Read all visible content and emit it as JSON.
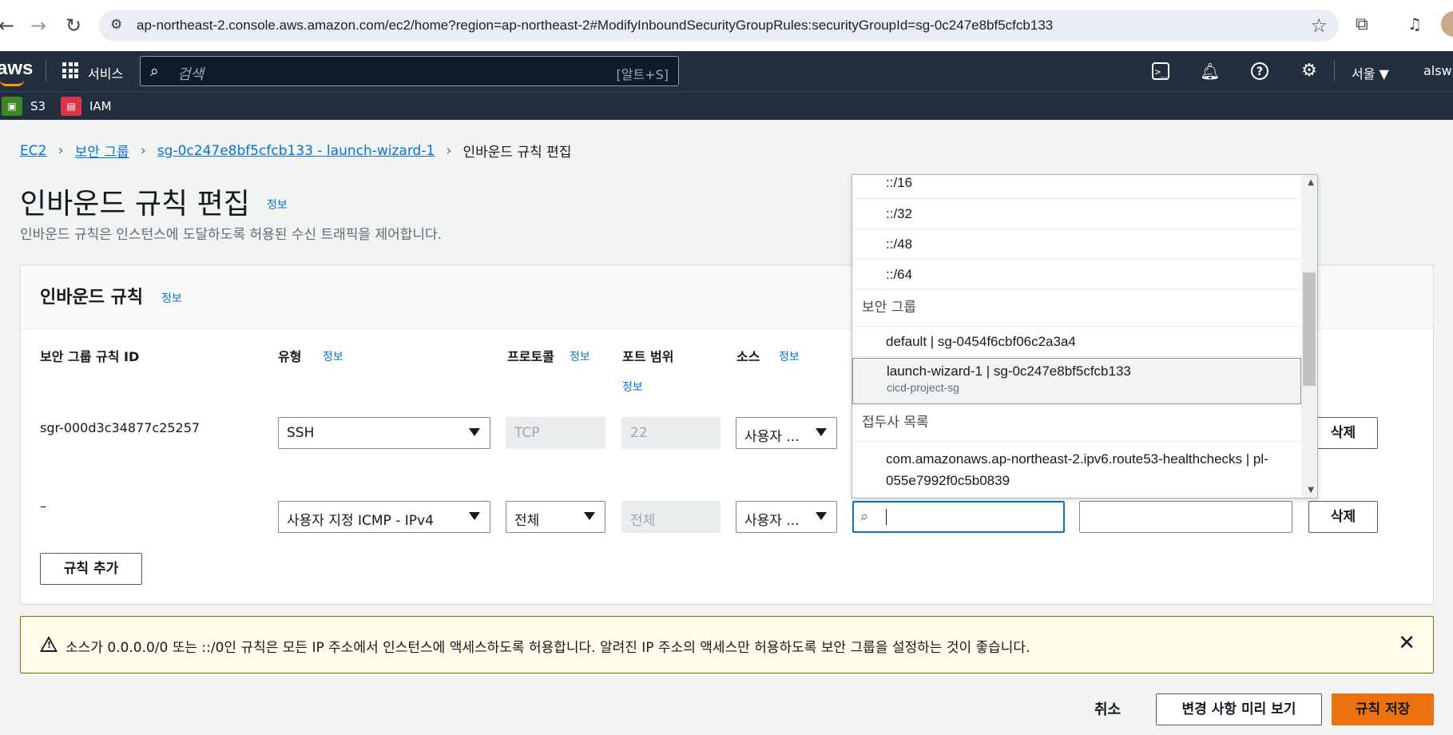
{
  "browser": {
    "url": "ap-northeast-2.console.aws.amazon.com/ec2/home?region=ap-northeast-2#ModifyInboundSecurityGroupRules:securityGroupId=sg-0c247e8bf5cfcb133"
  },
  "aws_nav": {
    "logo": "aws",
    "services_label": "서비스",
    "search_placeholder": "검색",
    "search_shortcut": "[알트+S]",
    "region": "서울 ▼",
    "account": "alswl"
  },
  "favorites": [
    {
      "label": "S3",
      "color": "#3f8624"
    },
    {
      "label": "IAM",
      "color": "#dd344c"
    }
  ],
  "breadcrumb": {
    "ec2": "EC2",
    "security_groups": "보안 그룹",
    "sg": "sg-0c247e8bf5cfcb133 - launch-wizard-1",
    "current": "인바운드 규칙 편집"
  },
  "page": {
    "title": "인바운드 규칙 편집",
    "info": "정보",
    "description": "인바운드 규칙은 인스턴스에 도달하도록 허용된 수신 트래픽을 제어합니다."
  },
  "panel": {
    "title": "인바운드 규칙",
    "info": "정보",
    "columns": {
      "rule_id": "보안 그룹 규칙 ID",
      "type": "유형",
      "protocol": "프로토콜",
      "port_range": "포트 범위",
      "source": "소스",
      "info": "정보"
    },
    "rows": [
      {
        "rule_id": "sgr-000d3c34877c25257",
        "type": "SSH",
        "protocol": "TCP",
        "port": "22",
        "source": "사용자 ...",
        "delete": "삭제"
      },
      {
        "rule_id": "–",
        "type": "사용자 지정 ICMP - IPv4",
        "protocol": "전체",
        "port": "전체",
        "source": "사용자 ...",
        "delete": "삭제"
      }
    ],
    "add_rule": "규칙 추가"
  },
  "dropdown": {
    "top_options": [
      "::/16",
      "::/32",
      "::/48",
      "::/64"
    ],
    "group_security": "보안 그룹",
    "sg_default": "default | sg-0454f6cbf06c2a3a4",
    "sg_launch": "launch-wizard-1 | sg-0c247e8bf5cfcb133",
    "sg_launch_desc": "cicd-project-sg",
    "group_prefix": "접두사 목록",
    "prefix_line1": "com.amazonaws.ap-northeast-2.ipv6.route53-healthchecks | pl-",
    "prefix_line2": "055e7992f0c5b0839"
  },
  "warning": {
    "message": "소스가 0.0.0.0/0 또는 ::/0인 규칙은 모든 IP 주소에서 인스턴스에 액세스하도록 허용합니다. 알려진 IP 주소의 액세스만 허용하도록 보안 그룹을 설정하는 것이 좋습니다."
  },
  "footer": {
    "cancel": "취소",
    "preview": "변경 사항 미리 보기",
    "save": "규칙 저장"
  },
  "colors": {
    "aws_nav": "#232f3e",
    "link": "#0972d3",
    "primary": "#ec7211",
    "warning_bg": "#fffce9"
  }
}
